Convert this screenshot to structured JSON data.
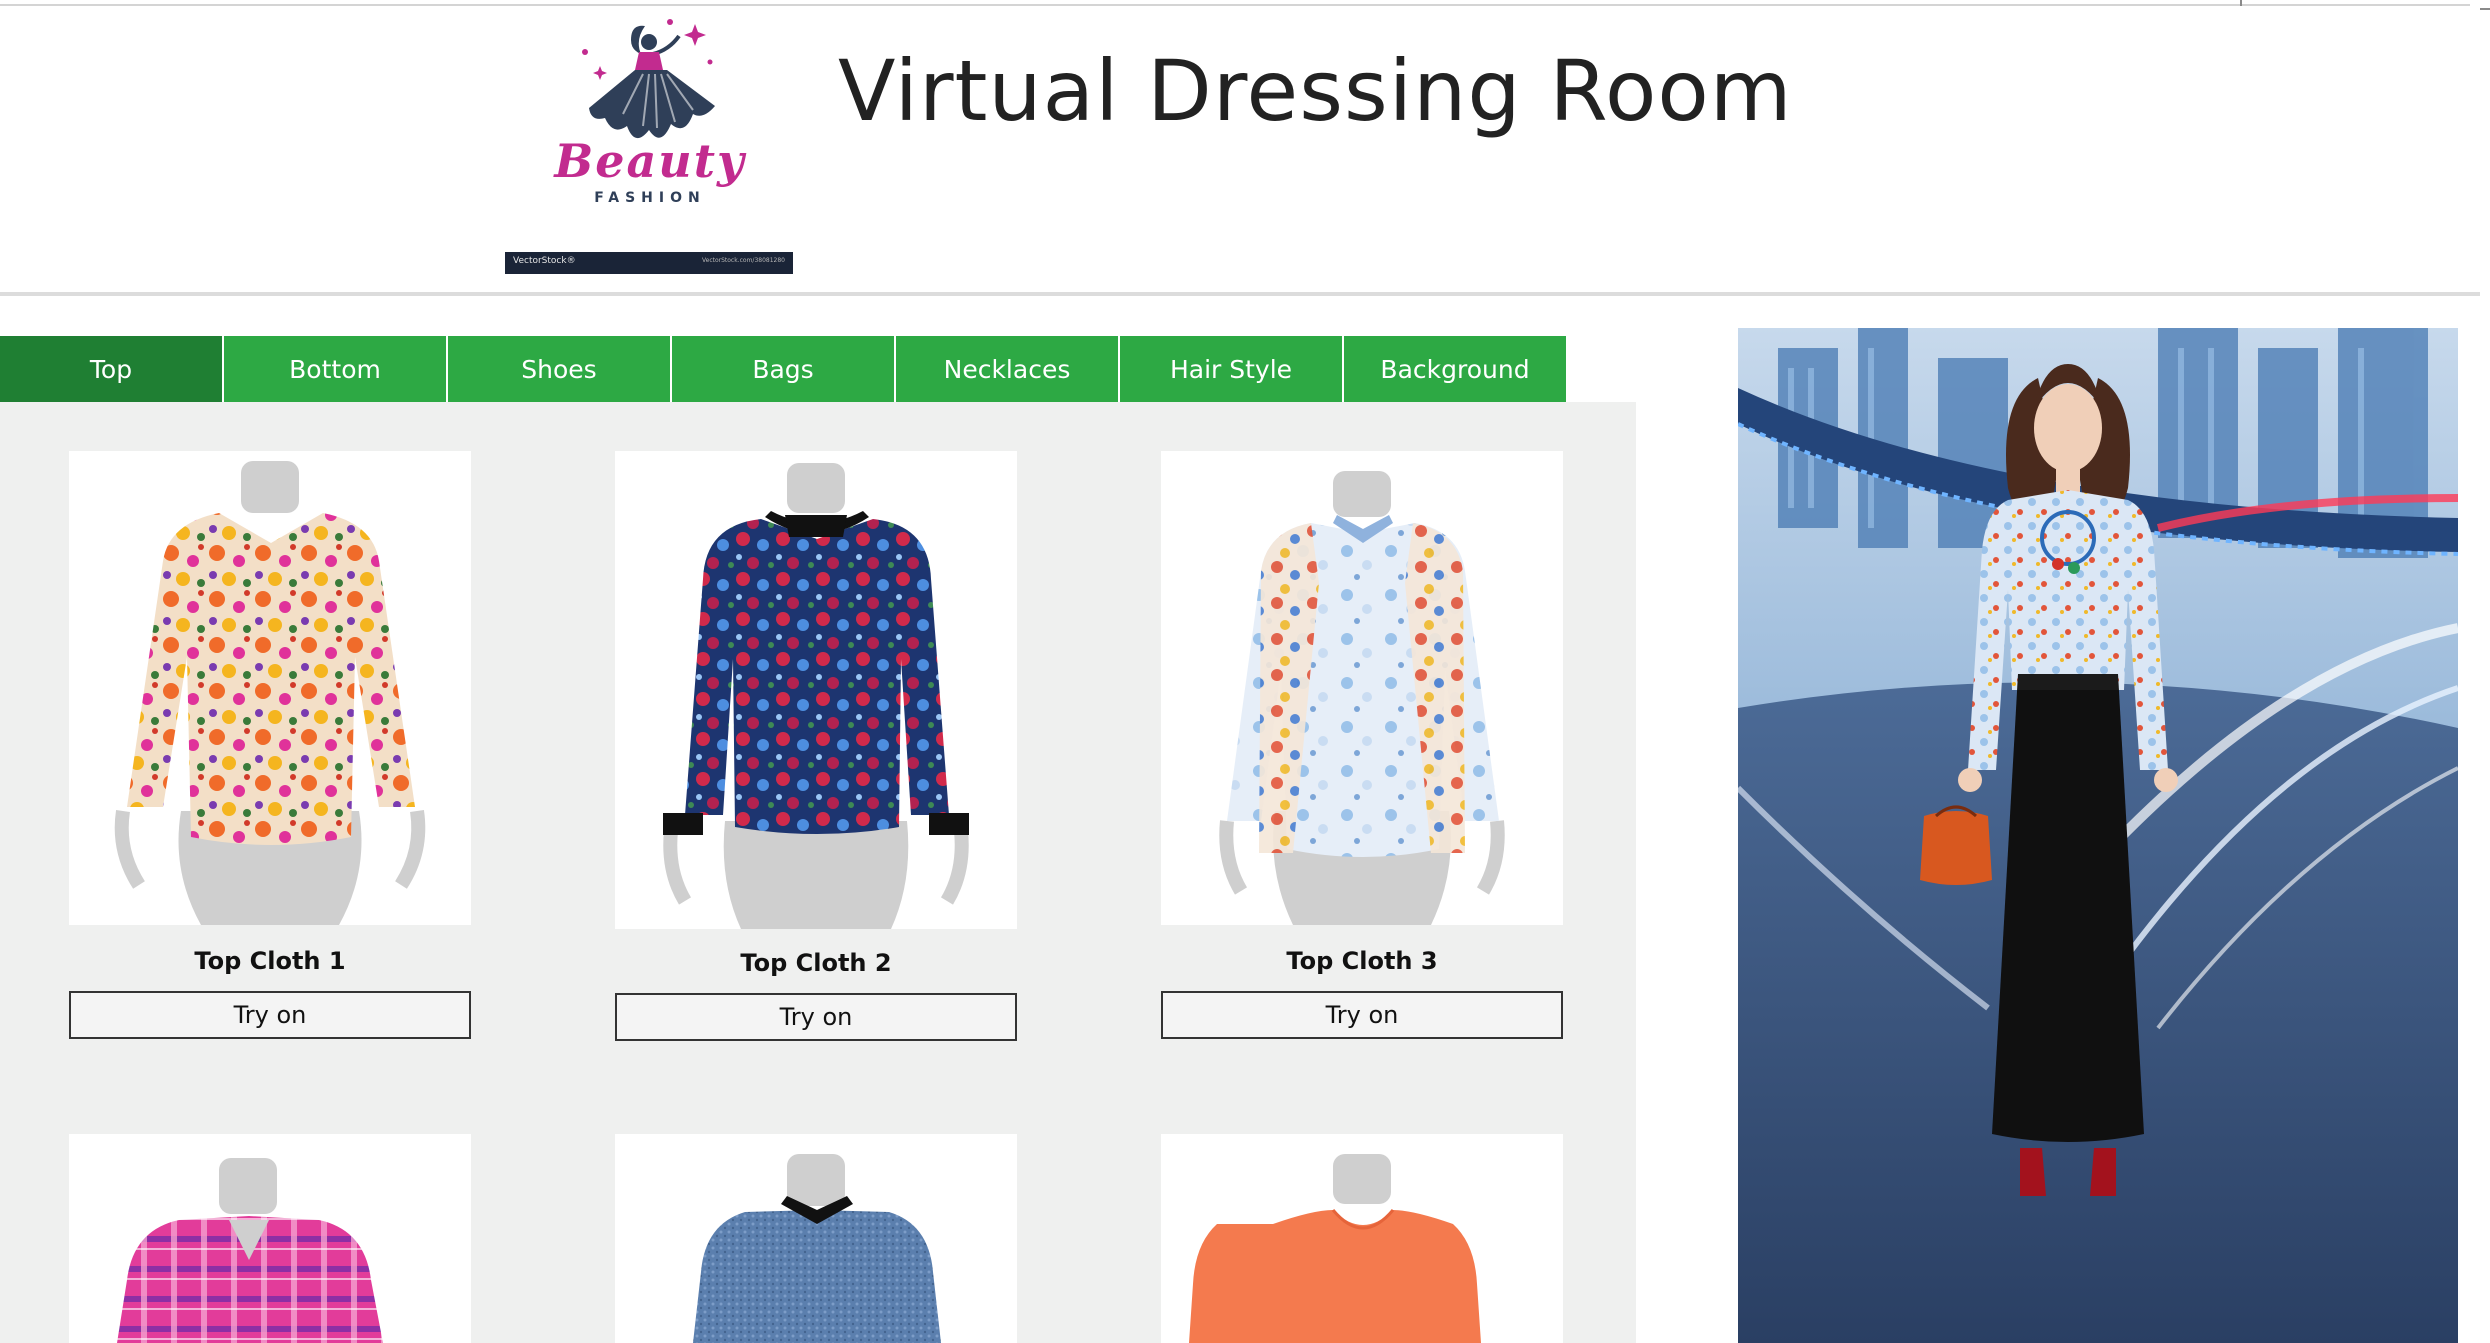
{
  "header": {
    "title": "Virtual Dressing Room",
    "logo": {
      "script_text": "Beauty",
      "sub_text": "FASHION",
      "watermark_left": "VectorStock®",
      "watermark_right": "VectorStock.com/38081280"
    }
  },
  "tabs": [
    {
      "label": "Top",
      "active": true
    },
    {
      "label": "Bottom",
      "active": false
    },
    {
      "label": "Shoes",
      "active": false
    },
    {
      "label": "Bags",
      "active": false
    },
    {
      "label": "Necklaces",
      "active": false
    },
    {
      "label": "Hair Style",
      "active": false
    },
    {
      "label": "Background",
      "active": false
    }
  ],
  "catalog": {
    "items": [
      {
        "name": "Top Cloth 1",
        "button": "Try on"
      },
      {
        "name": "Top Cloth 2",
        "button": "Try on"
      },
      {
        "name": "Top Cloth 3",
        "button": "Try on"
      }
    ]
  },
  "colors": {
    "tab_green": "#2da944",
    "tab_active": "#1f7f33",
    "panel_bg": "#eff0ef",
    "logo_pink": "#c22b8f",
    "logo_navy": "#2f3f58"
  },
  "icons": {
    "logo": "dancing-woman-logo",
    "mannequin": "mannequin-icon"
  }
}
